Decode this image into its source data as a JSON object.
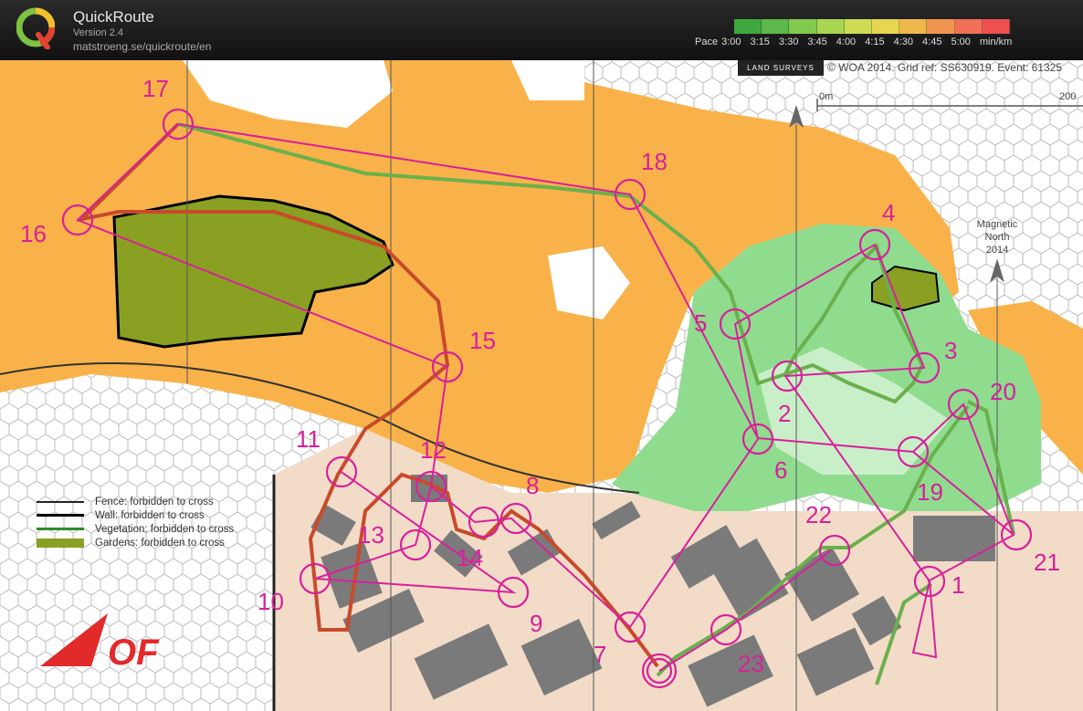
{
  "app": {
    "name": "QuickRoute",
    "version": "Version 2.4",
    "url": "matstroeng.se/quickroute/en"
  },
  "pace": {
    "label": "Pace",
    "ticks": [
      "3:00",
      "3:15",
      "3:30",
      "3:45",
      "4:00",
      "4:15",
      "4:30",
      "4:45",
      "5:00"
    ],
    "unit": "min/km",
    "colors": [
      "#3ea83e",
      "#5cb84a",
      "#82c94f",
      "#a8d653",
      "#cddc55",
      "#e8d64f",
      "#f0b84a",
      "#f29550",
      "#f07058",
      "#ee5050"
    ]
  },
  "map": {
    "credit": "WOA 2014. Grid ref: SS630919. Event: 61325",
    "surveyor": "LAND SURVEYS",
    "scale_start": "0m",
    "scale_end": "200",
    "magnetic_north": [
      "Magnetic",
      "North",
      "2014"
    ],
    "colors": {
      "open_land": "#f9b24a",
      "forest_green": "#7fd67f",
      "garden": "#8aa022",
      "building": "#7a7a7a",
      "paved": "#f2dcc8",
      "course": "#d8209b"
    }
  },
  "legend": [
    {
      "label": "Fence: forbidden to cross",
      "color": "#222222"
    },
    {
      "label": "Wall: forbidden to cross",
      "color": "#000000"
    },
    {
      "label": "Vegetation: forbidden to cross",
      "color": "#2e8a2e"
    },
    {
      "label": "Gardens: forbidden to cross",
      "color": "#8aa022"
    }
  ],
  "controls": [
    "1",
    "2",
    "3",
    "4",
    "5",
    "6",
    "7",
    "8",
    "9",
    "10",
    "11",
    "12",
    "13",
    "14",
    "15",
    "16",
    "17",
    "18",
    "19",
    "20",
    "21",
    "22",
    "23"
  ],
  "logo_text": "OF"
}
